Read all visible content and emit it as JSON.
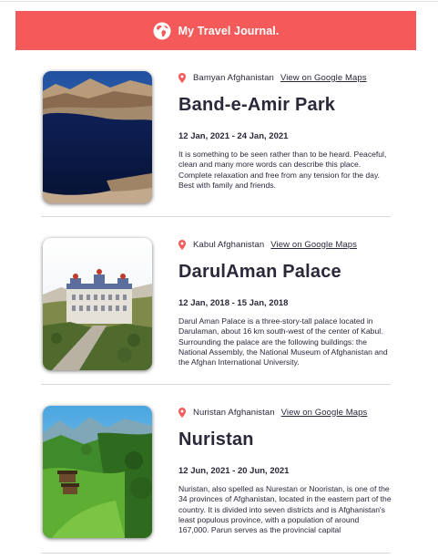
{
  "header": {
    "title": "My Travel Journal.",
    "icon": "globe-icon",
    "background": "#f55a5a"
  },
  "entries": [
    {
      "location": "Bamyan Afghanistan",
      "maps_link": "View on Google Maps",
      "title": "Band-e-Amir Park",
      "dates": "12 Jan, 2021 - 24 Jan, 2021",
      "description": "It is something to be seen rather than to be heard. Peaceful, clean and many more words can describe this place. Complete relaxation and free from any tension for the day. Best with family and friends.",
      "image": "lake-photo"
    },
    {
      "location": "Kabul Afghanistan",
      "maps_link": "View on Google Maps",
      "title": "DarulAman Palace",
      "dates": "12 Jan, 2018 - 15 Jan, 2018",
      "description": "Darul Aman Palace is a three-story-tall palace located in Darulaman, about 16 km south-west of the center of Kabul. Surrounding the palace are the following buildings: the National Assembly, the National Museum of Afghanistan and the Afghan International University.",
      "image": "palace-photo"
    },
    {
      "location": "Nuristan Afghanistan",
      "maps_link": "View on Google Maps",
      "title": "Nuristan",
      "dates": "12 Jun, 2021 - 20 Jun, 2021",
      "description": "Nuristan, also spelled as Nurestan or Nooristan, is one of the 34 provinces of Afghanistan, located in the eastern part of the country. It is divided into seven districts and is Afghanistan's least populous province, with a population of around 167,000. Parun serves as the provincial capital",
      "image": "valley-photo"
    }
  ]
}
